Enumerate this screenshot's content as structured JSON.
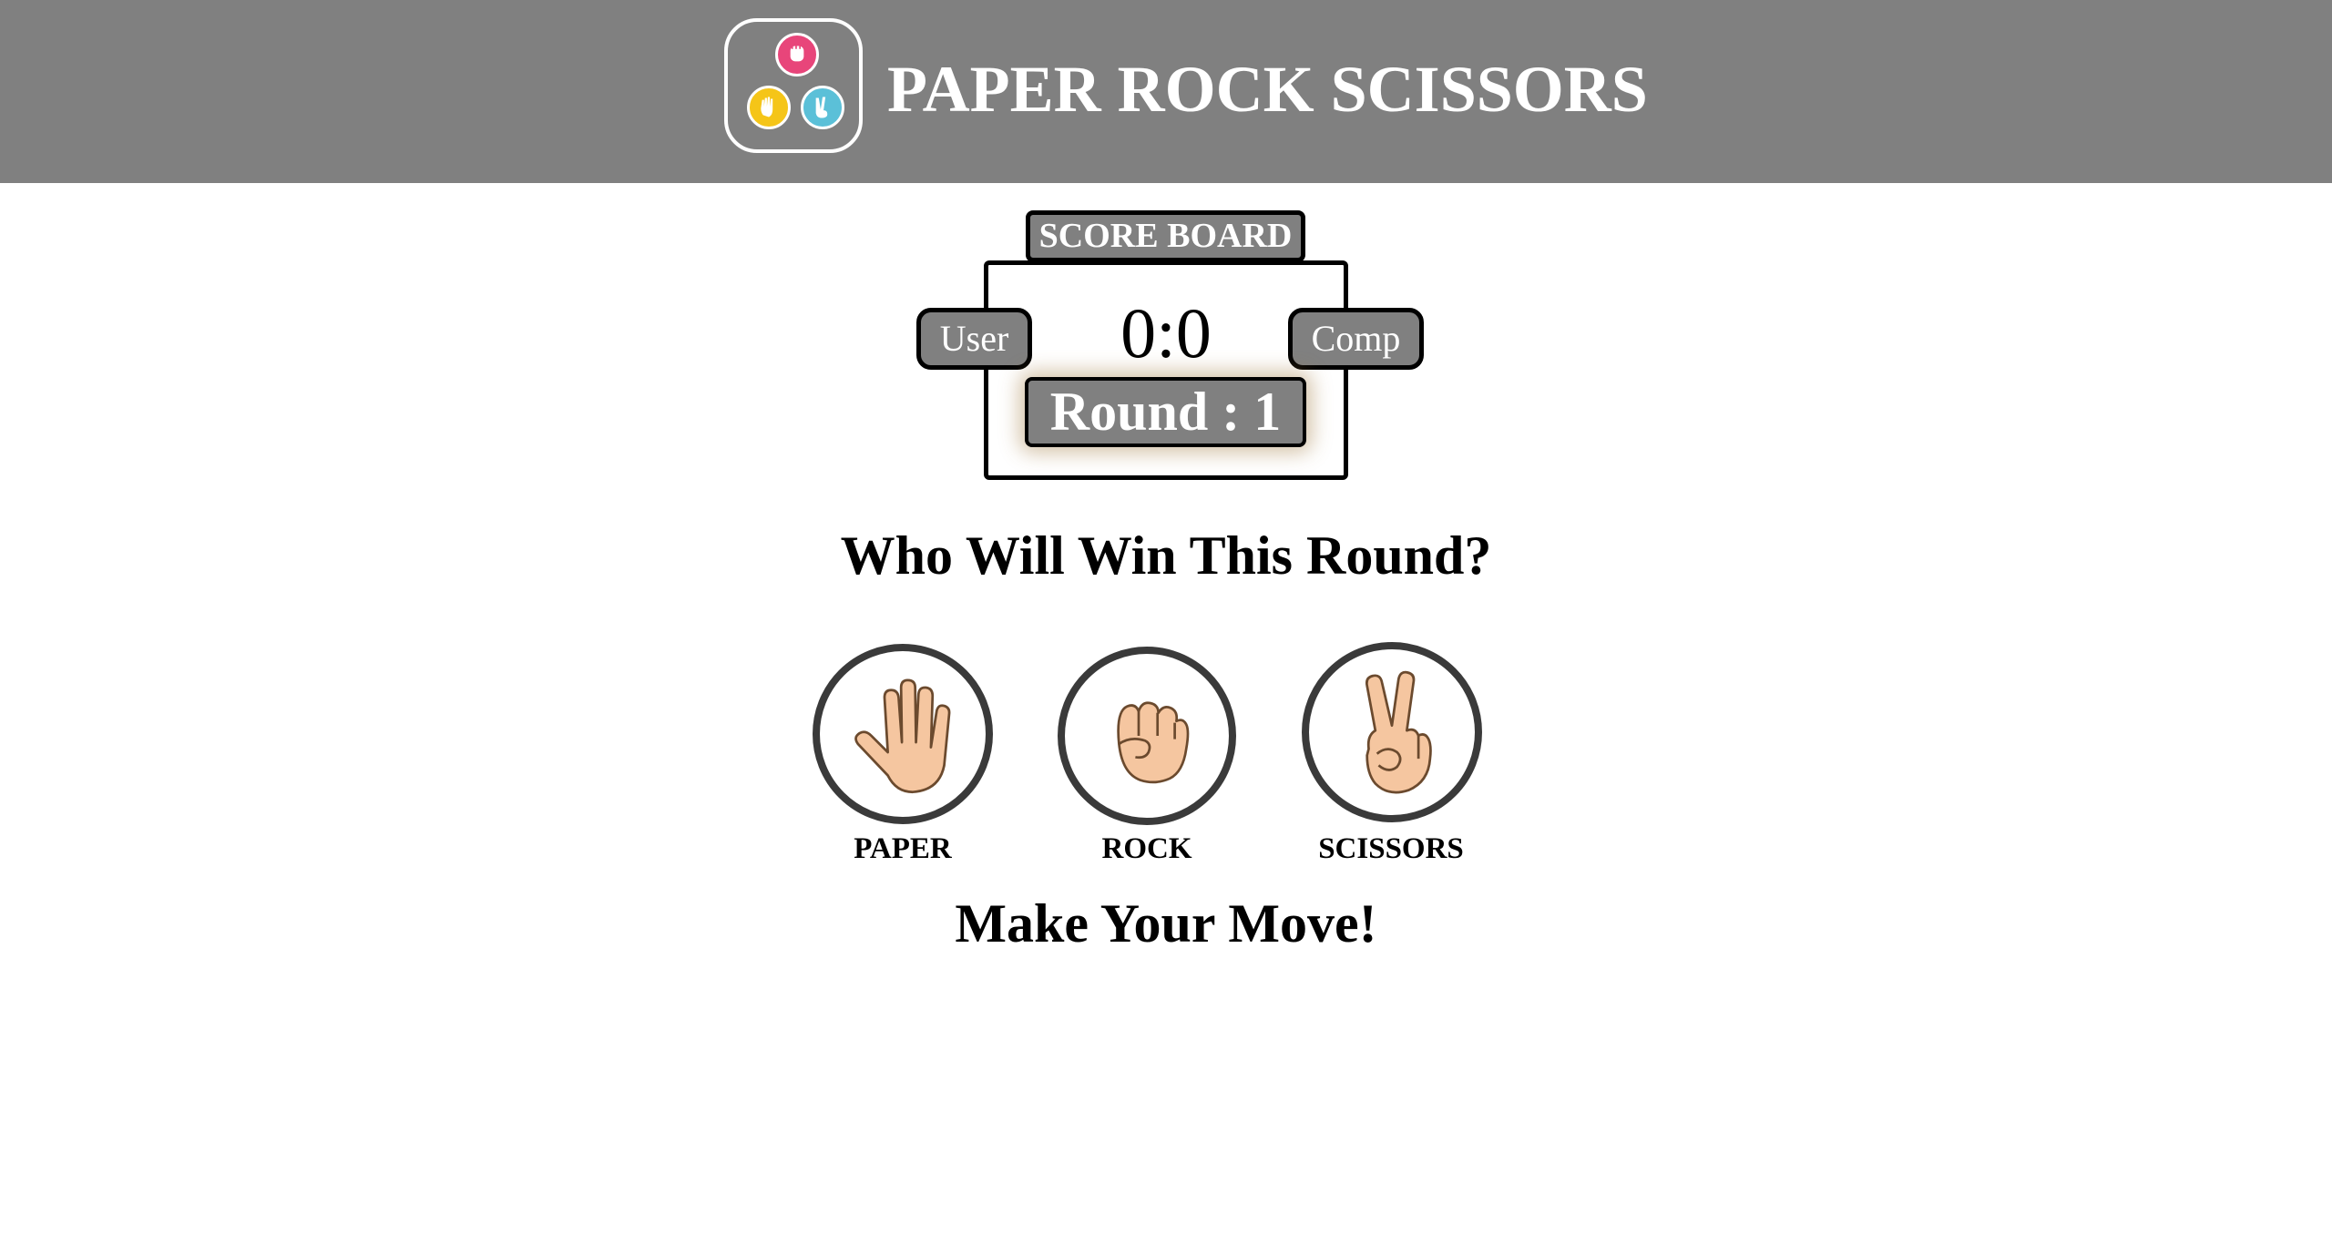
{
  "header": {
    "title": "PAPER ROCK SCISSORS",
    "background": "#808080",
    "logo": {
      "icons": [
        {
          "name": "fist-icon",
          "color": "#e8457a"
        },
        {
          "name": "open-hand-icon",
          "color": "#f5c518"
        },
        {
          "name": "peace-hand-icon",
          "color": "#5bc0d8"
        }
      ]
    }
  },
  "scoreboard": {
    "label": "SCORE BOARD",
    "user_label": "User",
    "comp_label": "Comp",
    "score": "0:0",
    "round": "Round : 1"
  },
  "prompt": {
    "question": "Who Will Win This Round?",
    "instruction": "Make Your Move!"
  },
  "choices": [
    {
      "id": "paper",
      "label": "PAPER",
      "icon": "open-hand-icon"
    },
    {
      "id": "rock",
      "label": "ROCK",
      "icon": "fist-icon"
    },
    {
      "id": "scissors",
      "label": "SCISSORS",
      "icon": "peace-hand-icon"
    }
  ],
  "colors": {
    "skin": "#f5c6a0",
    "outline": "#6b4a2e",
    "circle_border": "#3a3a3a"
  }
}
